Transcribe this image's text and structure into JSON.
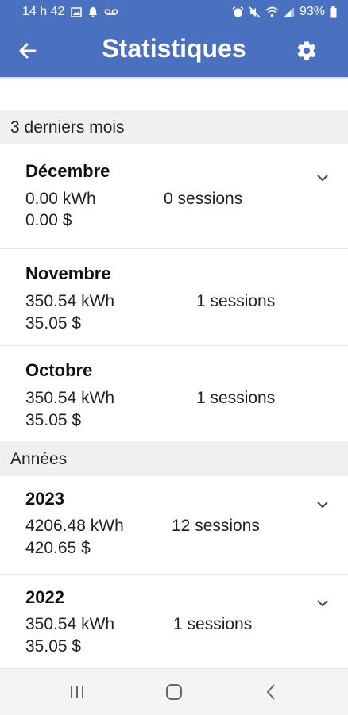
{
  "status_bar": {
    "time": "14 h 42",
    "battery": "93%"
  },
  "app_bar": {
    "title": "Statistiques",
    "back_icon": "arrow-left-icon",
    "settings_icon": "gear-icon"
  },
  "months_section": {
    "header": "3 derniers mois",
    "items": [
      {
        "title": "Décembre",
        "kwh": "0.00 kWh",
        "cost": "0.00 $",
        "sessions": "0 sessions",
        "expandable": true
      },
      {
        "title": "Novembre",
        "kwh": "350.54 kWh",
        "cost": "35.05 $",
        "sessions": "1 sessions",
        "expandable": false
      },
      {
        "title": "Octobre",
        "kwh": "350.54 kWh",
        "cost": "35.05 $",
        "sessions": "1 sessions",
        "expandable": false
      }
    ]
  },
  "years_section": {
    "header": "Années",
    "items": [
      {
        "title": "2023",
        "kwh": "4206.48 kWh",
        "cost": "420.65 $",
        "sessions": "12 sessions",
        "expandable": true
      },
      {
        "title": "2022",
        "kwh": "350.54 kWh",
        "cost": "35.05 $",
        "sessions": "1 sessions",
        "expandable": true
      }
    ]
  },
  "nav_bar": {
    "icons": [
      "recent-apps-icon",
      "home-icon",
      "back-icon"
    ]
  },
  "colors": {
    "primary": "#4a70c0",
    "section_bg": "#f0f0f0"
  }
}
